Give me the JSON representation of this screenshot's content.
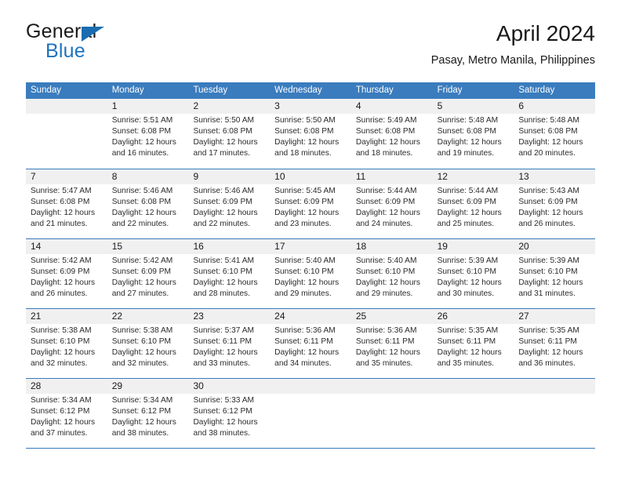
{
  "brand": {
    "name_part1": "General",
    "name_part2": "Blue",
    "accent_color": "#1a6cb0"
  },
  "header": {
    "title": "April 2024",
    "location": "Pasay, Metro Manila, Philippines"
  },
  "calendar": {
    "header_bg": "#3a7cbe",
    "day_band_bg": "#f0f0f0",
    "weekdays": [
      "Sunday",
      "Monday",
      "Tuesday",
      "Wednesday",
      "Thursday",
      "Friday",
      "Saturday"
    ],
    "weeks": [
      [
        {
          "day": "",
          "sunrise": "",
          "sunset": "",
          "daylight_line1": "",
          "daylight_line2": ""
        },
        {
          "day": "1",
          "sunrise": "Sunrise: 5:51 AM",
          "sunset": "Sunset: 6:08 PM",
          "daylight_line1": "Daylight: 12 hours",
          "daylight_line2": "and 16 minutes."
        },
        {
          "day": "2",
          "sunrise": "Sunrise: 5:50 AM",
          "sunset": "Sunset: 6:08 PM",
          "daylight_line1": "Daylight: 12 hours",
          "daylight_line2": "and 17 minutes."
        },
        {
          "day": "3",
          "sunrise": "Sunrise: 5:50 AM",
          "sunset": "Sunset: 6:08 PM",
          "daylight_line1": "Daylight: 12 hours",
          "daylight_line2": "and 18 minutes."
        },
        {
          "day": "4",
          "sunrise": "Sunrise: 5:49 AM",
          "sunset": "Sunset: 6:08 PM",
          "daylight_line1": "Daylight: 12 hours",
          "daylight_line2": "and 18 minutes."
        },
        {
          "day": "5",
          "sunrise": "Sunrise: 5:48 AM",
          "sunset": "Sunset: 6:08 PM",
          "daylight_line1": "Daylight: 12 hours",
          "daylight_line2": "and 19 minutes."
        },
        {
          "day": "6",
          "sunrise": "Sunrise: 5:48 AM",
          "sunset": "Sunset: 6:08 PM",
          "daylight_line1": "Daylight: 12 hours",
          "daylight_line2": "and 20 minutes."
        }
      ],
      [
        {
          "day": "7",
          "sunrise": "Sunrise: 5:47 AM",
          "sunset": "Sunset: 6:08 PM",
          "daylight_line1": "Daylight: 12 hours",
          "daylight_line2": "and 21 minutes."
        },
        {
          "day": "8",
          "sunrise": "Sunrise: 5:46 AM",
          "sunset": "Sunset: 6:08 PM",
          "daylight_line1": "Daylight: 12 hours",
          "daylight_line2": "and 22 minutes."
        },
        {
          "day": "9",
          "sunrise": "Sunrise: 5:46 AM",
          "sunset": "Sunset: 6:09 PM",
          "daylight_line1": "Daylight: 12 hours",
          "daylight_line2": "and 22 minutes."
        },
        {
          "day": "10",
          "sunrise": "Sunrise: 5:45 AM",
          "sunset": "Sunset: 6:09 PM",
          "daylight_line1": "Daylight: 12 hours",
          "daylight_line2": "and 23 minutes."
        },
        {
          "day": "11",
          "sunrise": "Sunrise: 5:44 AM",
          "sunset": "Sunset: 6:09 PM",
          "daylight_line1": "Daylight: 12 hours",
          "daylight_line2": "and 24 minutes."
        },
        {
          "day": "12",
          "sunrise": "Sunrise: 5:44 AM",
          "sunset": "Sunset: 6:09 PM",
          "daylight_line1": "Daylight: 12 hours",
          "daylight_line2": "and 25 minutes."
        },
        {
          "day": "13",
          "sunrise": "Sunrise: 5:43 AM",
          "sunset": "Sunset: 6:09 PM",
          "daylight_line1": "Daylight: 12 hours",
          "daylight_line2": "and 26 minutes."
        }
      ],
      [
        {
          "day": "14",
          "sunrise": "Sunrise: 5:42 AM",
          "sunset": "Sunset: 6:09 PM",
          "daylight_line1": "Daylight: 12 hours",
          "daylight_line2": "and 26 minutes."
        },
        {
          "day": "15",
          "sunrise": "Sunrise: 5:42 AM",
          "sunset": "Sunset: 6:09 PM",
          "daylight_line1": "Daylight: 12 hours",
          "daylight_line2": "and 27 minutes."
        },
        {
          "day": "16",
          "sunrise": "Sunrise: 5:41 AM",
          "sunset": "Sunset: 6:10 PM",
          "daylight_line1": "Daylight: 12 hours",
          "daylight_line2": "and 28 minutes."
        },
        {
          "day": "17",
          "sunrise": "Sunrise: 5:40 AM",
          "sunset": "Sunset: 6:10 PM",
          "daylight_line1": "Daylight: 12 hours",
          "daylight_line2": "and 29 minutes."
        },
        {
          "day": "18",
          "sunrise": "Sunrise: 5:40 AM",
          "sunset": "Sunset: 6:10 PM",
          "daylight_line1": "Daylight: 12 hours",
          "daylight_line2": "and 29 minutes."
        },
        {
          "day": "19",
          "sunrise": "Sunrise: 5:39 AM",
          "sunset": "Sunset: 6:10 PM",
          "daylight_line1": "Daylight: 12 hours",
          "daylight_line2": "and 30 minutes."
        },
        {
          "day": "20",
          "sunrise": "Sunrise: 5:39 AM",
          "sunset": "Sunset: 6:10 PM",
          "daylight_line1": "Daylight: 12 hours",
          "daylight_line2": "and 31 minutes."
        }
      ],
      [
        {
          "day": "21",
          "sunrise": "Sunrise: 5:38 AM",
          "sunset": "Sunset: 6:10 PM",
          "daylight_line1": "Daylight: 12 hours",
          "daylight_line2": "and 32 minutes."
        },
        {
          "day": "22",
          "sunrise": "Sunrise: 5:38 AM",
          "sunset": "Sunset: 6:10 PM",
          "daylight_line1": "Daylight: 12 hours",
          "daylight_line2": "and 32 minutes."
        },
        {
          "day": "23",
          "sunrise": "Sunrise: 5:37 AM",
          "sunset": "Sunset: 6:11 PM",
          "daylight_line1": "Daylight: 12 hours",
          "daylight_line2": "and 33 minutes."
        },
        {
          "day": "24",
          "sunrise": "Sunrise: 5:36 AM",
          "sunset": "Sunset: 6:11 PM",
          "daylight_line1": "Daylight: 12 hours",
          "daylight_line2": "and 34 minutes."
        },
        {
          "day": "25",
          "sunrise": "Sunrise: 5:36 AM",
          "sunset": "Sunset: 6:11 PM",
          "daylight_line1": "Daylight: 12 hours",
          "daylight_line2": "and 35 minutes."
        },
        {
          "day": "26",
          "sunrise": "Sunrise: 5:35 AM",
          "sunset": "Sunset: 6:11 PM",
          "daylight_line1": "Daylight: 12 hours",
          "daylight_line2": "and 35 minutes."
        },
        {
          "day": "27",
          "sunrise": "Sunrise: 5:35 AM",
          "sunset": "Sunset: 6:11 PM",
          "daylight_line1": "Daylight: 12 hours",
          "daylight_line2": "and 36 minutes."
        }
      ],
      [
        {
          "day": "28",
          "sunrise": "Sunrise: 5:34 AM",
          "sunset": "Sunset: 6:12 PM",
          "daylight_line1": "Daylight: 12 hours",
          "daylight_line2": "and 37 minutes."
        },
        {
          "day": "29",
          "sunrise": "Sunrise: 5:34 AM",
          "sunset": "Sunset: 6:12 PM",
          "daylight_line1": "Daylight: 12 hours",
          "daylight_line2": "and 38 minutes."
        },
        {
          "day": "30",
          "sunrise": "Sunrise: 5:33 AM",
          "sunset": "Sunset: 6:12 PM",
          "daylight_line1": "Daylight: 12 hours",
          "daylight_line2": "and 38 minutes."
        },
        {
          "day": "",
          "sunrise": "",
          "sunset": "",
          "daylight_line1": "",
          "daylight_line2": ""
        },
        {
          "day": "",
          "sunrise": "",
          "sunset": "",
          "daylight_line1": "",
          "daylight_line2": ""
        },
        {
          "day": "",
          "sunrise": "",
          "sunset": "",
          "daylight_line1": "",
          "daylight_line2": ""
        },
        {
          "day": "",
          "sunrise": "",
          "sunset": "",
          "daylight_line1": "",
          "daylight_line2": ""
        }
      ]
    ]
  }
}
